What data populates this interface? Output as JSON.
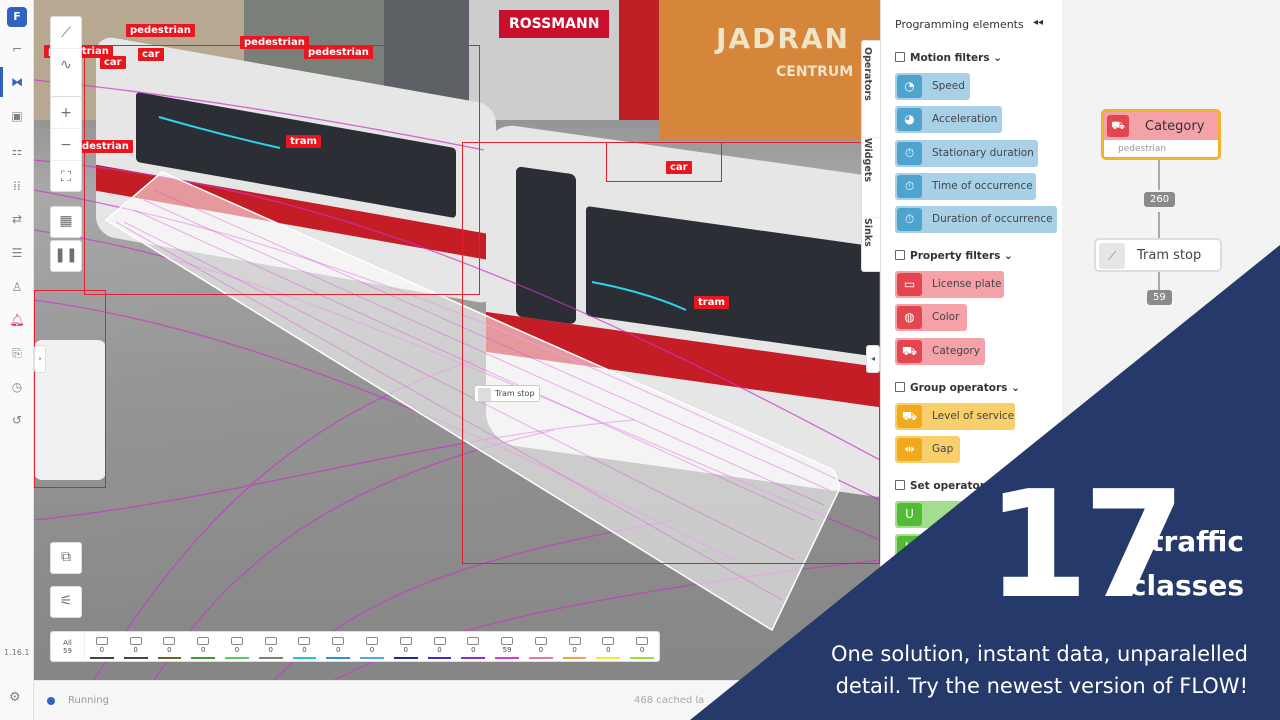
{
  "app": {
    "logo": "F",
    "version": "1.16.1"
  },
  "rail": {
    "icons": [
      "draw-scene-icon",
      "flow-icon",
      "widgets-icon",
      "operators-icon",
      "grid-icon",
      "transfer-icon",
      "storage-icon",
      "users-icon",
      "bell-icon",
      "export-icon",
      "clock-icon",
      "history-icon",
      "settings-icon"
    ]
  },
  "video": {
    "labels": [
      "pedestrian",
      "pedestrian",
      "pedestrian",
      "pedestrian",
      "pedestrian",
      "car",
      "car",
      "car",
      "tram",
      "tram",
      "car"
    ],
    "tram_stop_label": "Tram stop",
    "signs": [
      "ROSSMANN",
      "JADRAN",
      "CENTRUM"
    ]
  },
  "classbar": {
    "all_label": "All",
    "all_count": "59",
    "counts": [
      "0",
      "0",
      "0",
      "0",
      "0",
      "0",
      "0",
      "0",
      "0",
      "0",
      "0",
      "0",
      "59",
      "0",
      "0",
      "0",
      "0"
    ],
    "colors": [
      "#444444",
      "#444444",
      "#7b5b2a",
      "#3e9a3e",
      "#55cc66",
      "#7e7e7e",
      "#1fc7c7",
      "#2d8fd8",
      "#4bb2e0",
      "#1d2a8c",
      "#3b2bd0",
      "#8a2bd8",
      "#d83bd8",
      "#e87898",
      "#f4a040",
      "#f6e83b",
      "#9ae03b"
    ]
  },
  "status": {
    "state": "Running",
    "cached": "468 cached la"
  },
  "panel": {
    "title": "Programming elements",
    "tabs": [
      "Operators",
      "Widgets",
      "Sinks"
    ],
    "sections": {
      "motion": {
        "label": "Motion filters",
        "items": [
          "Speed",
          "Acceleration",
          "Stationary duration",
          "Time of occurrence",
          "Duration of occurrence"
        ]
      },
      "property": {
        "label": "Property filters",
        "items": [
          "License plate",
          "Color",
          "Category"
        ]
      },
      "group": {
        "label": "Group operators",
        "items": [
          "Level of service",
          "Gap"
        ]
      },
      "set": {
        "label": "Set operator",
        "items": [
          "U",
          "U"
        ]
      }
    }
  },
  "canvas": {
    "category_node": {
      "title": "Category",
      "subtitle": "pedestrian"
    },
    "count1": "260",
    "tramstop_node": {
      "title": "Tram stop"
    },
    "count2": "59"
  },
  "promo": {
    "number": "17",
    "line1": "traffic",
    "line2": "classes",
    "tagline1": "One solution, instant data, unparalelled",
    "tagline2": "detail. Try the newest version of FLOW!",
    "banner_color": "#253a6a"
  }
}
